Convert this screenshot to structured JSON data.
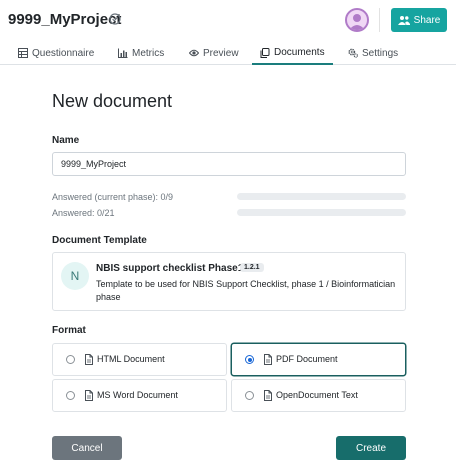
{
  "header": {
    "project_name": "9999_MyProject",
    "share_label": "Share"
  },
  "tabs": [
    {
      "label": "Questionnaire",
      "icon": "table-icon"
    },
    {
      "label": "Metrics",
      "icon": "bar-chart-icon"
    },
    {
      "label": "Preview",
      "icon": "eye-icon"
    },
    {
      "label": "Documents",
      "icon": "copy-icon",
      "active": true
    },
    {
      "label": "Settings",
      "icon": "gears-icon"
    }
  ],
  "page": {
    "title": "New document",
    "name_label": "Name",
    "name_value": "9999_MyProject",
    "progress_current": "Answered (current phase): 0/9",
    "progress_current_fraction": 0,
    "progress_total": "Answered: 0/21",
    "progress_total_fraction": 0,
    "template_label": "Document Template",
    "template": {
      "logo_letter": "N",
      "name": "NBIS support checklist Phase1",
      "version": "1.2.1",
      "description": "Template to be used for NBIS Support Checklist, phase 1 / Bioinformatician phase"
    },
    "format_label": "Format",
    "formats": [
      {
        "label": "HTML Document",
        "selected": false
      },
      {
        "label": "PDF Document",
        "selected": true
      },
      {
        "label": "MS Word Document",
        "selected": false
      },
      {
        "label": "OpenDocument Text",
        "selected": false
      }
    ],
    "cancel_label": "Cancel",
    "create_label": "Create"
  },
  "colors": {
    "accent": "#16a4a0",
    "primary_dark": "#176d6b",
    "secondary": "#6c757d",
    "radio_selected": "#1766d6"
  }
}
